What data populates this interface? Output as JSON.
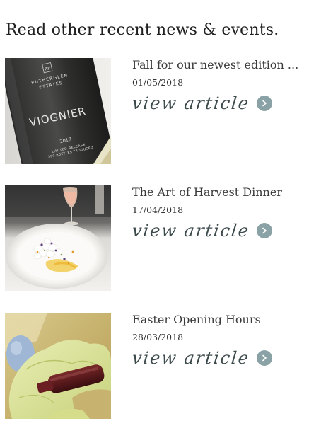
{
  "heading": "Read other recent news & events.",
  "articles": [
    {
      "title": "Fall for our newest edition ...",
      "date": "01/05/2018",
      "link_label": "view article",
      "image": {
        "label_brand_top": "RUTHERGLEN",
        "label_brand_bottom": "ESTATES",
        "label_monogram": "RE",
        "label_varietal": "VIOGNIER",
        "label_year": "2017",
        "label_release": "LIMITED RELEASE",
        "label_bottles": "1380 BOTTLES PRODUCED"
      }
    },
    {
      "title": "The Art of Harvest Dinner",
      "date": "17/04/2018",
      "link_label": "view article"
    },
    {
      "title": "Easter Opening Hours",
      "date": "28/03/2018",
      "link_label": "view article"
    }
  ],
  "colors": {
    "accent": "#8aa2a5",
    "link_text": "#3d4a4c",
    "heading": "#1f1f1f"
  }
}
